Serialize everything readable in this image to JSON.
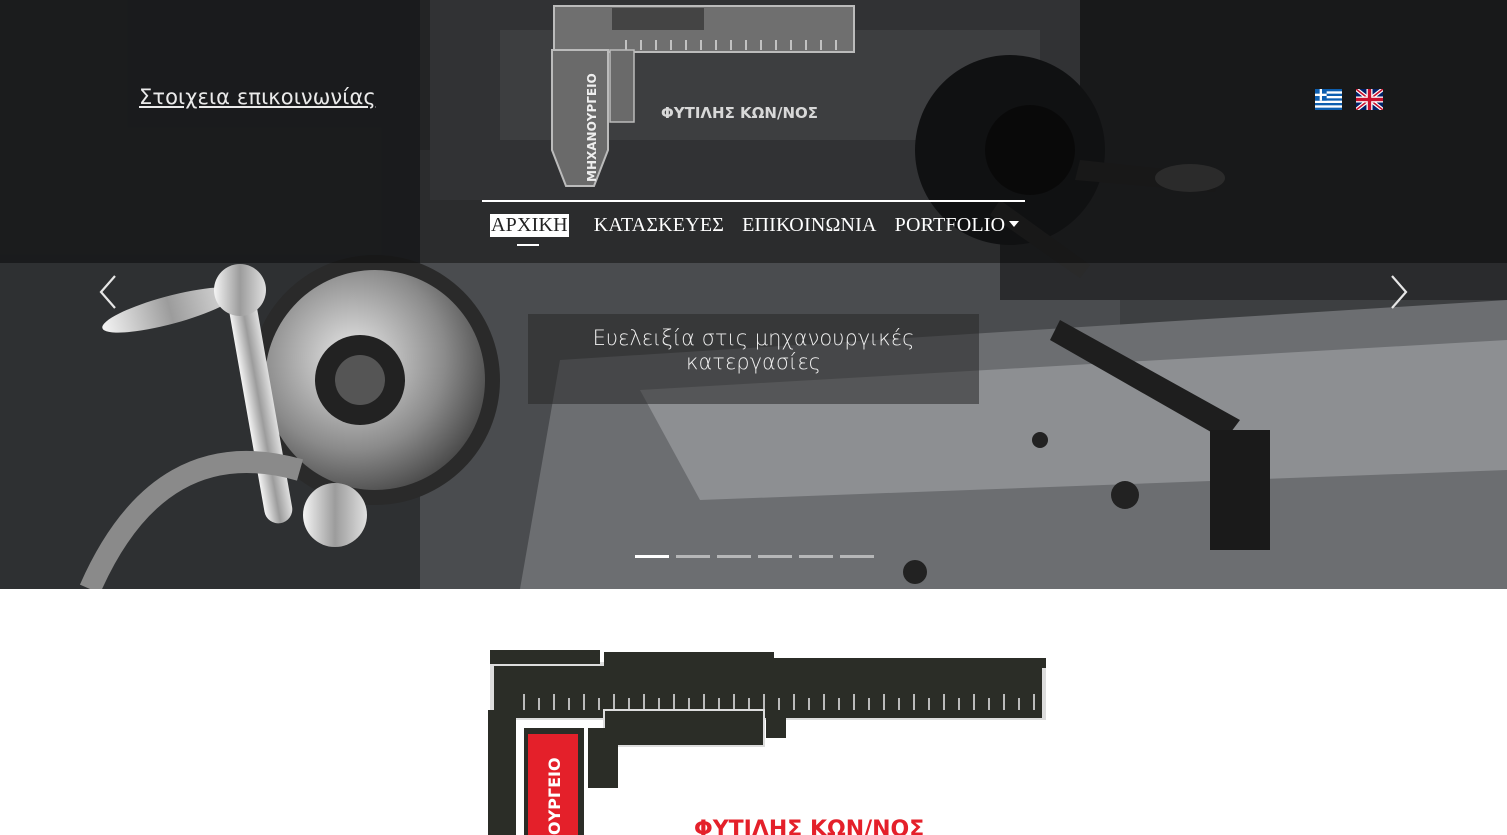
{
  "header": {
    "contact_link": "Στοιχεια επικοινωνίας",
    "logo_side_text": "ΜΗΧΑΝΟΥΡΓΕΙΟ",
    "logo_name": "ΦΥΤΙΛΗΣ ΚΩΝ/ΝΟΣ",
    "languages": [
      {
        "name": "greek-flag"
      },
      {
        "name": "uk-flag"
      }
    ]
  },
  "nav": {
    "items": [
      {
        "label": "ΑΡΧΙΚΗ",
        "active": true
      },
      {
        "label": "ΚΑΤΑΣΚΕΥΕΣ"
      },
      {
        "label": "ΕΠΙΚΟΙΝΩΝΙΑ"
      },
      {
        "label": "PORTFOLIO",
        "dropdown": true
      }
    ]
  },
  "carousel": {
    "caption": "Ευελειξία στις μηχανουργικές κατεργασίες",
    "slide_count": 6,
    "active_slide": 1
  },
  "colors": {
    "nav_active_bg": "#ffffff",
    "logo_red": "#e4202a"
  },
  "logo_bottom": {
    "side_text": "ΟΥΡΓΕΙΟ",
    "name": "ΦΥΤΙΛΗΣ ΚΩΝ/ΝΟΣ"
  }
}
